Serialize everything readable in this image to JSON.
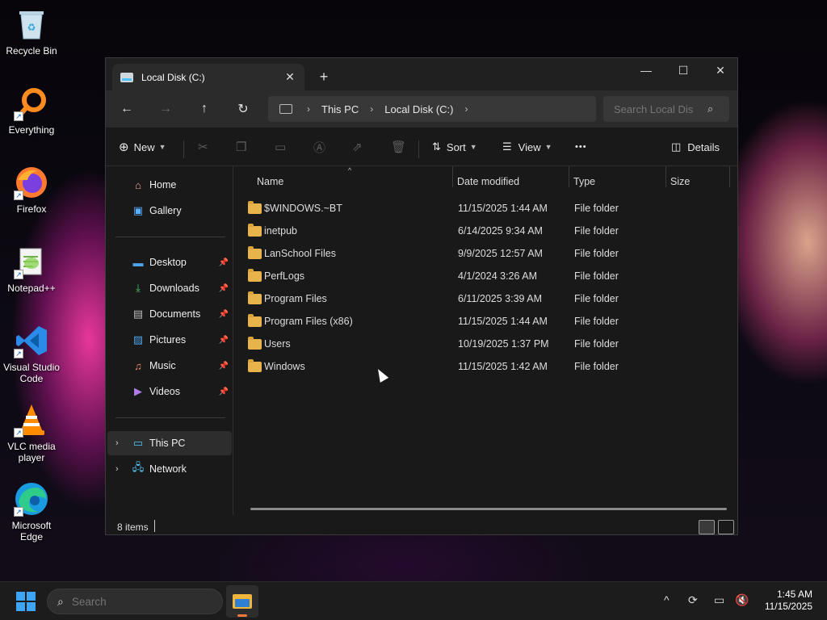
{
  "desktop": {
    "icons": [
      {
        "label": "Recycle Bin",
        "icon": "recycle-bin-icon"
      },
      {
        "label": "Everything",
        "icon": "everything-icon"
      },
      {
        "label": "Firefox",
        "icon": "firefox-icon"
      },
      {
        "label": "Notepad++",
        "icon": "notepad-plus-plus-icon"
      },
      {
        "label": "Visual Studio Code",
        "icon": "vscode-icon"
      },
      {
        "label": "VLC media player",
        "icon": "vlc-icon"
      },
      {
        "label": "Microsoft Edge",
        "icon": "edge-icon"
      }
    ]
  },
  "window": {
    "tab_title": "Local Disk (C:)",
    "tab_close": "✕",
    "new_tab": "+",
    "minimize": "—",
    "maximize": "☐",
    "close": "✕"
  },
  "nav": {
    "back": "←",
    "forward": "→",
    "up": "↑",
    "refresh": "↻",
    "breadcrumb": [
      "This PC",
      "Local Disk (C:)"
    ],
    "chevron": "›",
    "search_placeholder": "Search Local Dis"
  },
  "toolbar": {
    "new_label": "New",
    "sort_label": "Sort",
    "view_label": "View",
    "more": "•••",
    "details_label": "Details"
  },
  "sidebar": {
    "top": [
      {
        "label": "Home",
        "icon": "home-icon"
      },
      {
        "label": "Gallery",
        "icon": "gallery-icon"
      }
    ],
    "quick": [
      {
        "label": "Desktop",
        "icon": "desktop-icon"
      },
      {
        "label": "Downloads",
        "icon": "downloads-icon"
      },
      {
        "label": "Documents",
        "icon": "documents-icon"
      },
      {
        "label": "Pictures",
        "icon": "pictures-icon"
      },
      {
        "label": "Music",
        "icon": "music-icon"
      },
      {
        "label": "Videos",
        "icon": "videos-icon"
      }
    ],
    "bottom": [
      {
        "label": "This PC",
        "icon": "this-pc-icon"
      },
      {
        "label": "Network",
        "icon": "network-icon"
      }
    ]
  },
  "columns": {
    "name": "Name",
    "date": "Date modified",
    "type": "Type",
    "size": "Size"
  },
  "files": [
    {
      "name": "$WINDOWS.~BT",
      "date": "11/15/2025 1:44 AM",
      "type": "File folder"
    },
    {
      "name": "inetpub",
      "date": "6/14/2025 9:34 AM",
      "type": "File folder"
    },
    {
      "name": "LanSchool Files",
      "date": "9/9/2025 12:57 AM",
      "type": "File folder"
    },
    {
      "name": "PerfLogs",
      "date": "4/1/2024 3:26 AM",
      "type": "File folder"
    },
    {
      "name": "Program Files",
      "date": "6/11/2025 3:39 AM",
      "type": "File folder"
    },
    {
      "name": "Program Files (x86)",
      "date": "11/15/2025 1:44 AM",
      "type": "File folder"
    },
    {
      "name": "Users",
      "date": "10/19/2025 1:37 PM",
      "type": "File folder"
    },
    {
      "name": "Windows",
      "date": "11/15/2025 1:42 AM",
      "type": "File folder"
    }
  ],
  "status": {
    "items_count": "8 items"
  },
  "taskbar": {
    "search_placeholder": "Search",
    "time": "1:45 AM",
    "date": "11/15/2025"
  }
}
